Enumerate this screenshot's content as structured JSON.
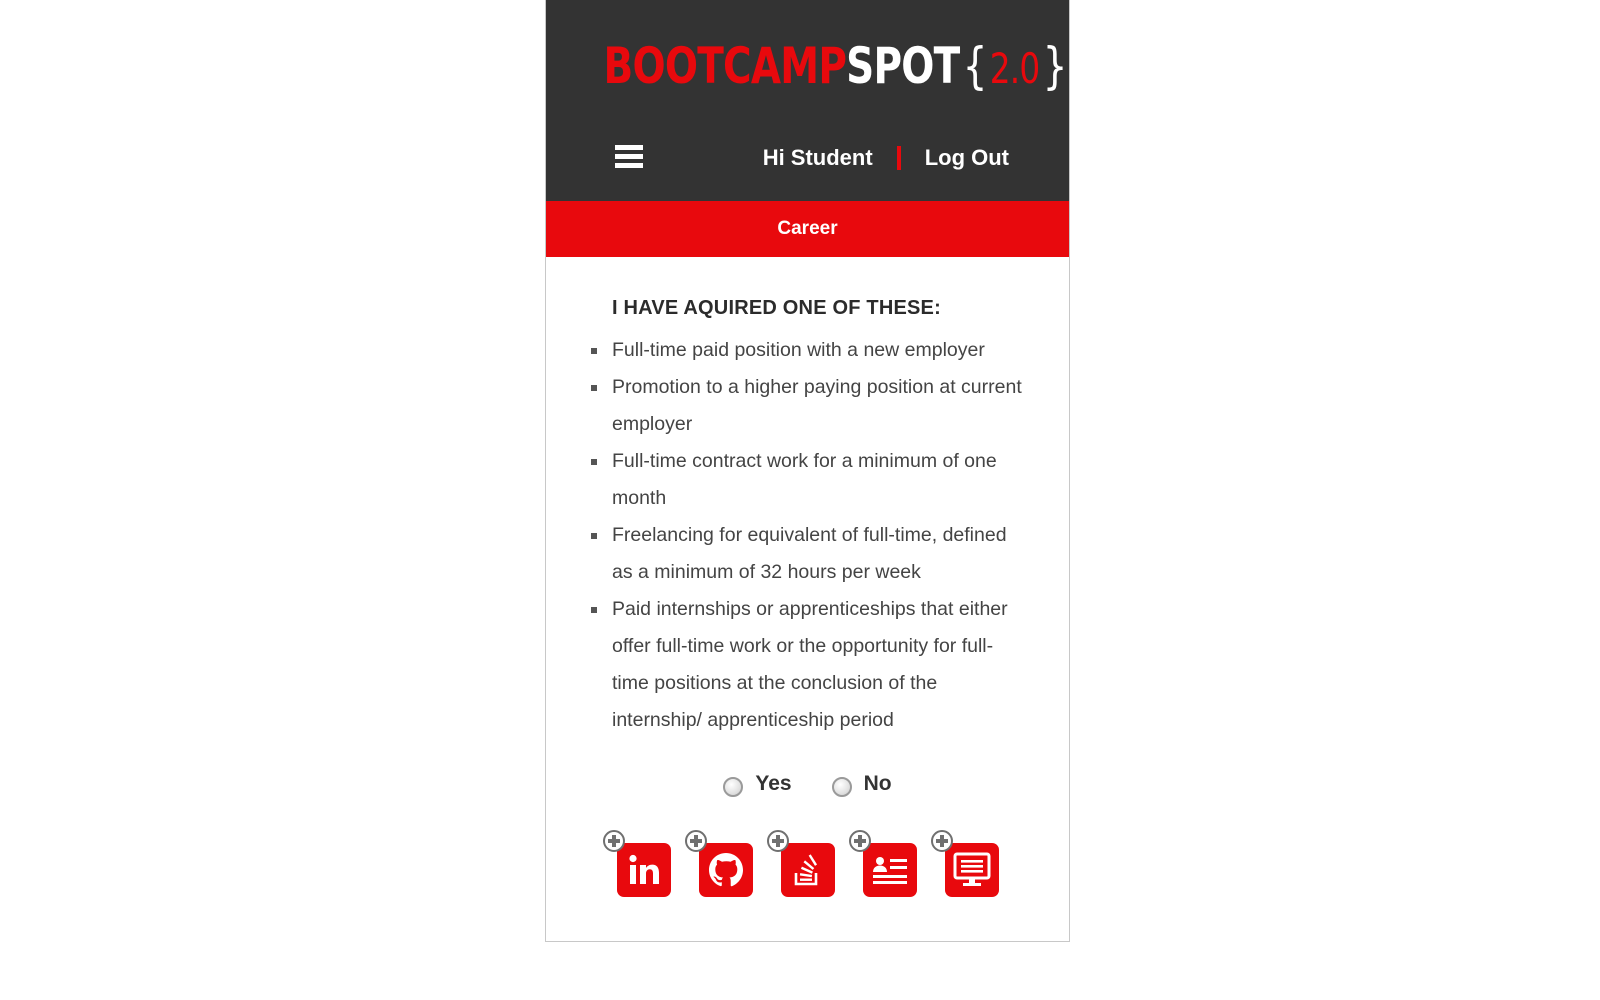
{
  "header": {
    "logo_bootcamp": "BOOTCAMP",
    "logo_spot": "SPOT",
    "logo_brace_open": "{",
    "logo_version": "2.0",
    "logo_brace_close": "}",
    "greeting": "Hi Student",
    "logout_label": "Log Out"
  },
  "section_bar": {
    "label": "Career"
  },
  "criteria": {
    "heading": "I HAVE AQUIRED ONE OF THESE:",
    "items": [
      "Full-time paid position with a new employer",
      "Promotion to a higher paying position at current employer",
      "Full-time contract work for a minimum of one month",
      "Freelancing for equivalent of full-time, defined as a minimum of 32 hours per week",
      "Paid internships or apprenticeships that either offer full-time work or the opportunity for full-time positions at the conclusion of the internship/ apprenticeship period"
    ]
  },
  "answer": {
    "yes_label": "Yes",
    "no_label": "No"
  },
  "social_links": [
    {
      "icon": "linkedin-icon"
    },
    {
      "icon": "github-icon"
    },
    {
      "icon": "stackoverflow-icon"
    },
    {
      "icon": "resume-icon"
    },
    {
      "icon": "portfolio-icon"
    }
  ],
  "colors": {
    "header_bg": "#333333",
    "accent_red": "#e8090d"
  }
}
